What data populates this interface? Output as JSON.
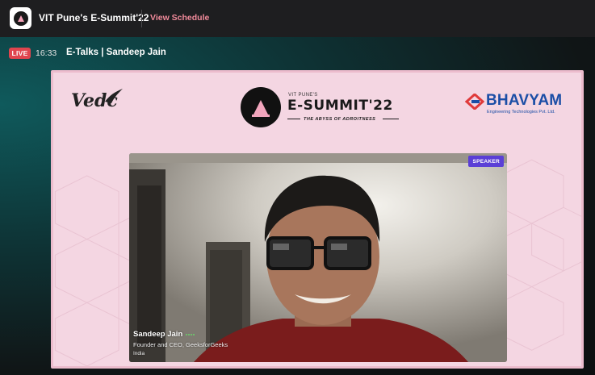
{
  "header": {
    "event_title": "VIT Pune's E-Summit'22",
    "schedule_link": "View Schedule",
    "logo_icon": "event-logo-icon"
  },
  "session": {
    "live_label": "LIVE",
    "time": "16:33",
    "title": "E-Talks | Sandeep Jain"
  },
  "slide": {
    "left_logo": "Vedc",
    "center_logo": {
      "small": "VIT PUNE'S",
      "big": "E-SUMMIT'22",
      "tagline": "THE ABYSS OF ADROITNESS"
    },
    "right_logo": {
      "name": "BHAVYAM",
      "subtitle": "Engineering Technologies Pvt. Ltd."
    }
  },
  "video": {
    "badge": "SPEAKER",
    "speaker_name": "Sandeep Jain",
    "speaker_role": "Founder and CEO, GeeksforGeeks",
    "speaker_location": "India"
  },
  "colors": {
    "live": "#e0454e",
    "link": "#f08a9a",
    "speaker_badge": "#5b3fd6",
    "slide_bg": "#f4d6e2",
    "brand_blue": "#1b4ea6"
  }
}
